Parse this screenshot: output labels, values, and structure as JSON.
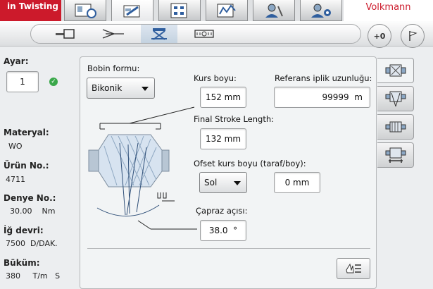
{
  "header": {
    "brand_label": "in Twisting",
    "company": "Volkmann",
    "tabs": [
      {
        "icon": "machine-refresh-icon"
      },
      {
        "icon": "spindle-edit-icon"
      },
      {
        "icon": "grid-settings-icon"
      },
      {
        "icon": "graph-chart-icon"
      },
      {
        "icon": "user-tools-icon"
      },
      {
        "icon": "user-settings-icon"
      }
    ]
  },
  "subtoolbar": {
    "tabs": [
      {
        "icon": "bobbin-side-icon"
      },
      {
        "icon": "yarn-twist-icon"
      },
      {
        "icon": "cross-wind-icon"
      },
      {
        "icon": "measure-tape-icon"
      }
    ],
    "right_buttons": [
      {
        "icon": "plus-zero-icon",
        "label": "+0"
      },
      {
        "icon": "flag-icon"
      }
    ]
  },
  "left_panel": {
    "ayar_label": "Ayar:",
    "ayar_value": "1",
    "status_icon": "ok-check-icon",
    "items": [
      {
        "label": "Materyal:",
        "value": "WO"
      },
      {
        "label": "Ürün No.:",
        "value": "4711"
      },
      {
        "label": "Denye No.:",
        "value": "30.00    Nm"
      },
      {
        "label": "İğ devri:",
        "value": "7500  D/DAK."
      },
      {
        "label": "Büküm:",
        "value": "380     T/m   S"
      }
    ]
  },
  "main": {
    "bobin_formu_label": "Bobin formu:",
    "bobin_formu_value": "Bikonik",
    "kurs_boyu_label": "Kurs boyu:",
    "kurs_boyu_value": "152 mm",
    "referans_label": "Referans iplik uzunluğu:",
    "referans_value": "99999  m",
    "final_stroke_label": "Final Stroke Length:",
    "final_stroke_value": "132 mm",
    "ofset_label": "Ofset kurs boyu (taraf/boy):",
    "ofset_select_value": "Sol",
    "ofset_value": "0 mm",
    "capraz_label": "Çapraz açısı:",
    "capraz_value": "38.0  °"
  },
  "side_tabs": [
    {
      "icon": "bobbin-front-icon"
    },
    {
      "icon": "bobbin-cross-icon"
    },
    {
      "icon": "bobbin-roll-icon"
    },
    {
      "icon": "bobbin-stand-icon"
    }
  ],
  "bottom_button": {
    "icon": "hand-list-icon"
  },
  "colors": {
    "brand": "#cc1a2b",
    "ok": "#3aa84a"
  }
}
